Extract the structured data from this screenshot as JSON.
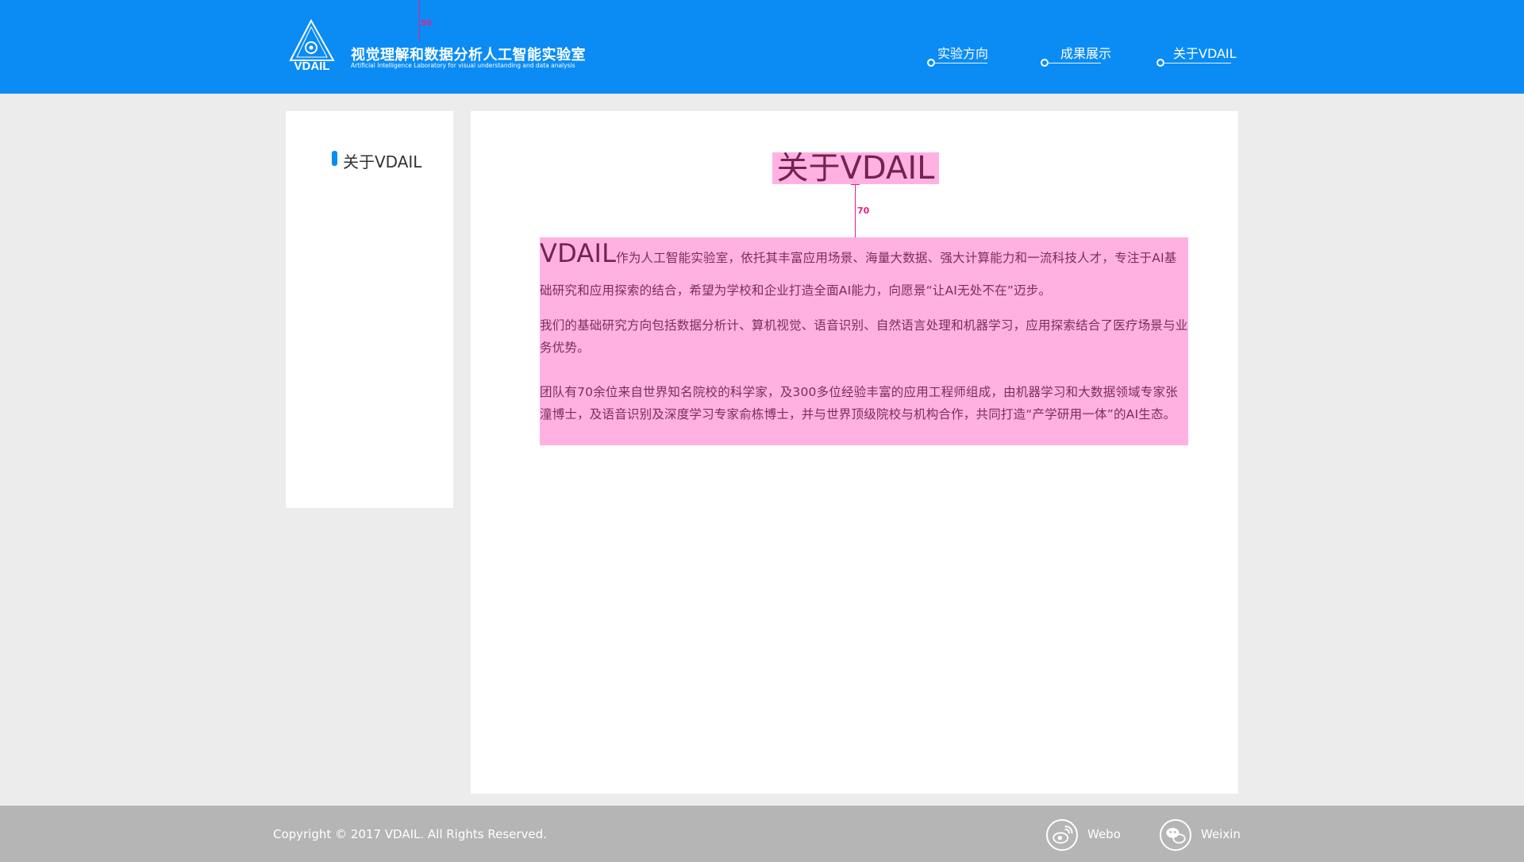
{
  "header": {
    "brand_title": "视觉理解和数据分析人工智能实验室",
    "brand_sub": "Artificial Intelligence Laboratory for visual understanding and data analysis",
    "logo_text": "VDAIL",
    "measure_label": "50",
    "nav": [
      {
        "label": "实验方向"
      },
      {
        "label": "成果展示"
      },
      {
        "label": "关于VDAIL"
      }
    ]
  },
  "sidebar": {
    "items": [
      {
        "label": "关于VDAIL"
      }
    ]
  },
  "main": {
    "title": "关于VDAIL",
    "measure_label": "70",
    "lead": "VDAIL",
    "p1_rest": "作为人工智能实验室，依托其丰富应用场景、海量大数据、强大计算能力和一流科技人才，专注于AI基础研究和应用探索的结合，希望为学校和企业打造全面AI能力，向愿景“让AI无处不在”迈步。",
    "p2": "我们的基础研究方向包括数据分析计、算机视觉、语音识别、自然语言处理和机器学习，应用探索结合了医疗场景与业务优势。",
    "p3": "团队有70余位来自世界知名院校的科学家，及300多位经验丰富的应用工程师组成，由机器学习和大数据领域专家张潼博士，及语音识别及深度学习专家俞栋博士，并与世界顶级院校与机构合作，共同打造“产学研用一体”的AI生态。"
  },
  "footer": {
    "copyright": "Copyright ©   2017   VDAIL. All Rights Reserved.",
    "social": [
      {
        "label": "Webo",
        "icon": "weibo-icon"
      },
      {
        "label": "Weixin",
        "icon": "wechat-icon"
      }
    ]
  },
  "colors": {
    "header_bg": "#0b8cf5",
    "page_bg": "#ececec",
    "highlight": "#ffb2e2",
    "measure": "#e0218a",
    "footer_bg": "#b5b5b5"
  }
}
